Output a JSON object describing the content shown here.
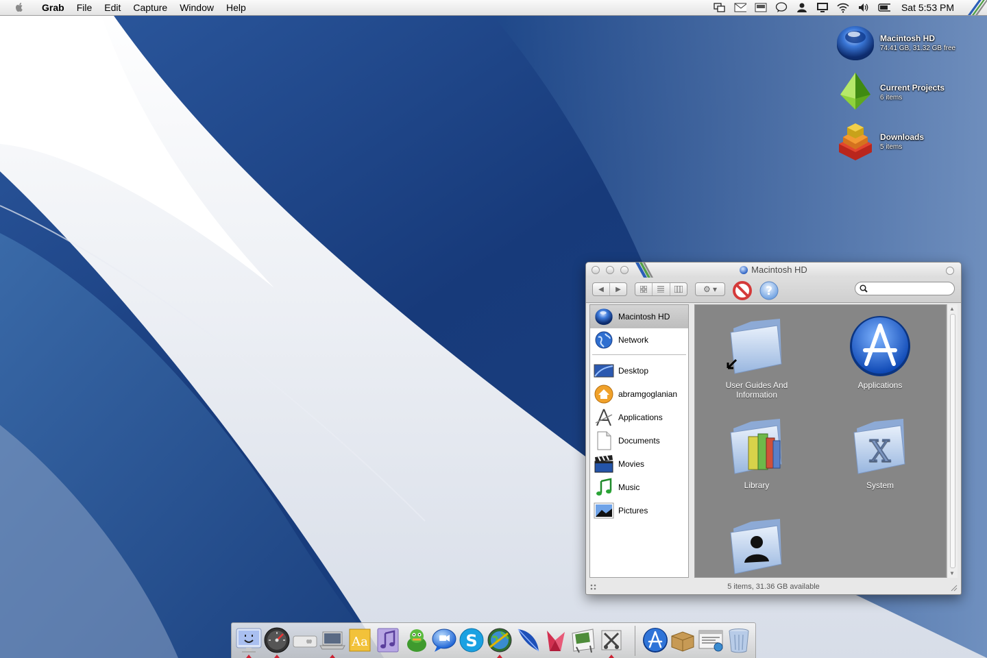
{
  "menubar": {
    "apple_icon": "apple-logo-icon",
    "app_name": "Grab",
    "menus": [
      "File",
      "Edit",
      "Capture",
      "Window",
      "Help"
    ],
    "status_icons": [
      "spaces-icon",
      "mail-icon",
      "display-icon",
      "chat-icon",
      "user-icon",
      "monitor-icon",
      "wifi-icon",
      "volume-icon",
      "battery-icon"
    ],
    "clock": "Sat 5:53 PM"
  },
  "desktop": {
    "icons": [
      {
        "name": "Macintosh HD",
        "sub": "74.41 GB, 31.32 GB free",
        "icon": "hard-drive-icon"
      },
      {
        "name": "Current Projects",
        "sub": "6 items",
        "icon": "projects-folder-icon"
      },
      {
        "name": "Downloads",
        "sub": "5 items",
        "icon": "downloads-folder-icon"
      }
    ]
  },
  "window": {
    "title": "Macintosh HD",
    "search_placeholder": "",
    "sidebar": {
      "devices": [
        {
          "label": "Macintosh HD",
          "icon": "hard-drive-icon",
          "selected": true
        },
        {
          "label": "Network",
          "icon": "network-globe-icon",
          "selected": false
        }
      ],
      "places": [
        {
          "label": "Desktop",
          "icon": "desktop-icon"
        },
        {
          "label": "abramgoglanian",
          "icon": "home-icon"
        },
        {
          "label": "Applications",
          "icon": "applications-icon"
        },
        {
          "label": "Documents",
          "icon": "documents-icon"
        },
        {
          "label": "Movies",
          "icon": "movies-icon"
        },
        {
          "label": "Music",
          "icon": "music-icon"
        },
        {
          "label": "Pictures",
          "icon": "pictures-icon"
        }
      ]
    },
    "items": [
      {
        "label": "User Guides And Information",
        "icon": "alias-folder-icon"
      },
      {
        "label": "Applications",
        "icon": "app-store-icon"
      },
      {
        "label": "Library",
        "icon": "library-folder-icon"
      },
      {
        "label": "System",
        "icon": "system-folder-icon"
      },
      {
        "label": "",
        "icon": "users-folder-icon"
      }
    ],
    "status": "5 items, 31.36 GB available"
  },
  "dock": {
    "apps": [
      "finder-icon",
      "dashboard-icon",
      "mac-mini-icon",
      "laptop-icon",
      "font-book-icon",
      "itunes-icon",
      "adium-icon",
      "ichat-icon",
      "skype-icon",
      "network-utility-icon",
      "feather-icon",
      "origami-icon",
      "preview-icon",
      "utility-icon"
    ],
    "others": [
      "app-store-icon",
      "package-icon",
      "web-icon",
      "trash-icon"
    ]
  },
  "colors": {
    "desktop_blue": "#1f4a8c",
    "accent": "#2f64c4",
    "content_bg": "#868686"
  }
}
